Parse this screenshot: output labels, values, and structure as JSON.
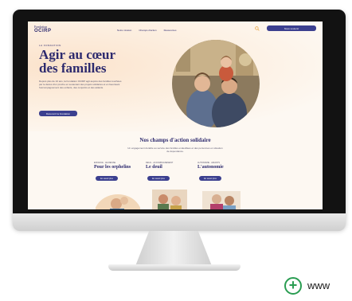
{
  "site": {
    "logo_line1": "Fondation",
    "logo_line2": "OCIRP",
    "nav": [
      "Notre mission",
      "Champs d'action",
      "Ressources"
    ],
    "header_button": "Nous soutenir"
  },
  "hero": {
    "eyebrow": "LA FONDATION",
    "title": "Agir au cœur des familles",
    "description": "Depuis plus de 10 ans, la Fondation OCIRP agit auprès des familles touchées par le décès d'un proche en soutenant des projets solidaires et en favorisant l'accompagnement des enfants, des conjoints et des aidants.",
    "button": "Découvrir la Fondation"
  },
  "section": {
    "title": "Nos champs d'action solidaire",
    "subtitle": "Un engagement durable au service des familles endeuillées et des personnes en situation de dépendance."
  },
  "cards": [
    {
      "eyebrow": "ENFANCE · JEUNESSE",
      "title": "Pour les orphelins",
      "button": "En savoir plus"
    },
    {
      "eyebrow": "DEUIL · ACCOMPAGNEMENT",
      "title": "Le deuil",
      "button": "En savoir plus"
    },
    {
      "eyebrow": "AUTONOMIE · AIDANTS",
      "title": "L'autonomie",
      "button": "En savoir plus"
    }
  ],
  "badge": {
    "plus": "+",
    "url_text": "www"
  },
  "colors": {
    "brand": "#2d2a6e",
    "button": "#3b3f8f",
    "accent_green": "#2a9d52",
    "peach": "#fbe3cc"
  }
}
